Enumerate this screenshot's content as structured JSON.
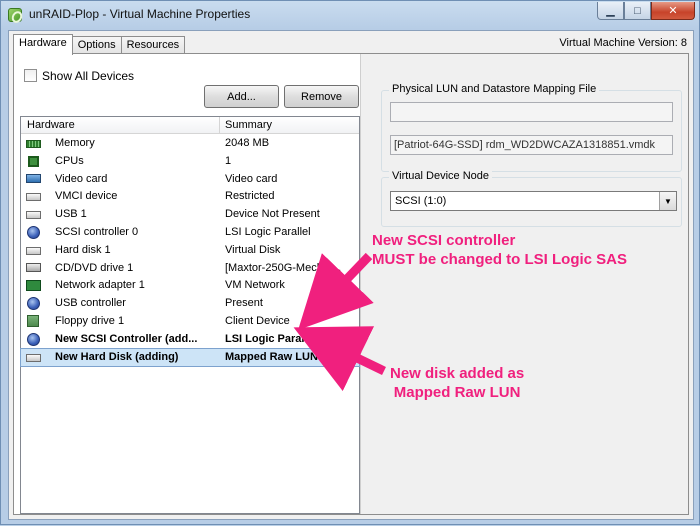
{
  "window": {
    "title": "unRAID-Plop - Virtual Machine Properties",
    "min_icon": "minimize-icon",
    "max_icon": "maximize-icon",
    "close_label": "✕"
  },
  "tabs": [
    {
      "label": "Hardware",
      "active": true
    },
    {
      "label": "Options",
      "active": false
    },
    {
      "label": "Resources",
      "active": false
    }
  ],
  "vm_version": "Virtual Machine Version: 8",
  "left": {
    "show_all_label": "Show All Devices",
    "add_label": "Add...",
    "remove_label": "Remove",
    "columns": {
      "hardware": "Hardware",
      "summary": "Summary"
    },
    "rows": [
      {
        "icon": "memory-icon",
        "name": "Memory",
        "summary": "2048 MB"
      },
      {
        "icon": "cpu-icon",
        "name": "CPUs",
        "summary": "1"
      },
      {
        "icon": "video-card-icon",
        "name": "Video card",
        "summary": "Video card"
      },
      {
        "icon": "vmci-device-icon",
        "name": "VMCI device",
        "summary": "Restricted"
      },
      {
        "icon": "usb-icon",
        "name": "USB 1",
        "summary": "Device Not Present"
      },
      {
        "icon": "scsi-controller-icon",
        "name": "SCSI controller 0",
        "summary": "LSI Logic Parallel"
      },
      {
        "icon": "hard-disk-icon",
        "name": "Hard disk 1",
        "summary": "Virtual Disk"
      },
      {
        "icon": "cd-dvd-icon",
        "name": "CD/DVD drive 1",
        "summary": "[Maxtor-250G-Mech] I..."
      },
      {
        "icon": "network-adapter-icon",
        "name": "Network adapter 1",
        "summary": "VM Network"
      },
      {
        "icon": "usb-controller-icon",
        "name": "USB controller",
        "summary": "Present"
      },
      {
        "icon": "floppy-drive-icon",
        "name": "Floppy drive 1",
        "summary": "Client Device"
      },
      {
        "icon": "scsi-controller-icon",
        "name": "New SCSI Controller (add...",
        "summary": "LSI Logic Parallel"
      },
      {
        "icon": "hard-disk-icon",
        "name": "New Hard Disk (adding)",
        "summary": "Mapped Raw LUN"
      }
    ]
  },
  "right": {
    "physical_group_title": "Physical LUN and Datastore Mapping File",
    "lun_value": "",
    "vmdk_value": "[Patriot-64G-SSD] rdm_WD2DWCAZA1318851.vmdk",
    "node_group_title": "Virtual Device Node",
    "node_value": "SCSI (1:0)"
  },
  "annotations": {
    "scsi_line1": "New SCSI controller",
    "scsi_line2": "MUST be changed to LSI Logic SAS",
    "disk_line1": "New disk added as",
    "disk_line2": "Mapped Raw LUN",
    "color": "#f0207e"
  }
}
